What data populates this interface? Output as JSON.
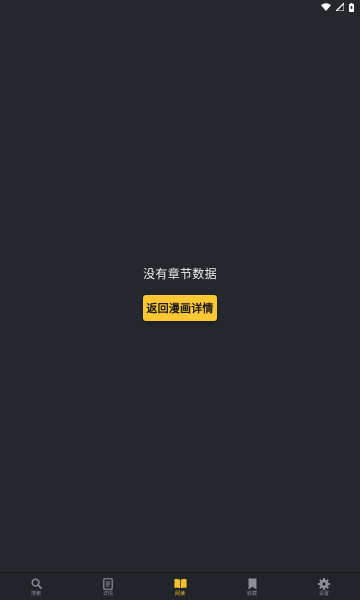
{
  "empty_state": {
    "message": "没有章节数据",
    "button_label": "返回漫画详情"
  },
  "bottom_nav": {
    "items": [
      {
        "label": "搜索",
        "icon": "search-icon",
        "active": false
      },
      {
        "label": "详情",
        "icon": "document-icon",
        "active": false
      },
      {
        "label": "阅读",
        "icon": "book-icon",
        "active": true
      },
      {
        "label": "收藏",
        "icon": "bookmark-icon",
        "active": false
      },
      {
        "label": "设置",
        "icon": "gear-icon",
        "active": false
      }
    ]
  },
  "colors": {
    "background": "#24272c",
    "accent": "#fcc732",
    "nav_inactive": "#8c9096",
    "nav_active": "#f7c22a"
  }
}
